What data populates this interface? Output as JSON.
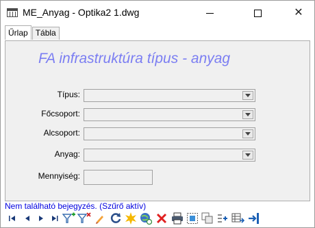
{
  "window": {
    "title": "ME_Anyag - Optika2 1.dwg",
    "minimize_symbol": "—",
    "maximize_symbol": "☐",
    "close_symbol": "✕"
  },
  "tabs": [
    {
      "label": "Űrlap",
      "active": true
    },
    {
      "label": "Tábla",
      "active": false
    }
  ],
  "form": {
    "title": "FA infrastruktúra típus - anyag",
    "title_color": "#7b7ef2",
    "fields": [
      {
        "label": "Típus:",
        "value": ""
      },
      {
        "label": "Főcsoport:",
        "value": ""
      },
      {
        "label": "Alcsoport:",
        "value": ""
      },
      {
        "label": "Anyag:",
        "value": ""
      }
    ],
    "quantity": {
      "label": "Mennyiség:",
      "value": ""
    }
  },
  "status": {
    "text": "Nem található bejegyzés. (Szűrő aktív)",
    "color": "#0000e0"
  },
  "navigation": {
    "icons": [
      "first-record-icon",
      "previous-record-icon",
      "next-record-icon",
      "last-record-icon",
      "add-filter-icon",
      "remove-filter-icon",
      "edit-icon",
      "refresh-icon",
      "new-record-icon",
      "globe-link-icon",
      "delete-icon",
      "print-icon",
      "select-icon",
      "copy-icon",
      "split-icon",
      "table-export-icon",
      "exit-icon"
    ]
  }
}
